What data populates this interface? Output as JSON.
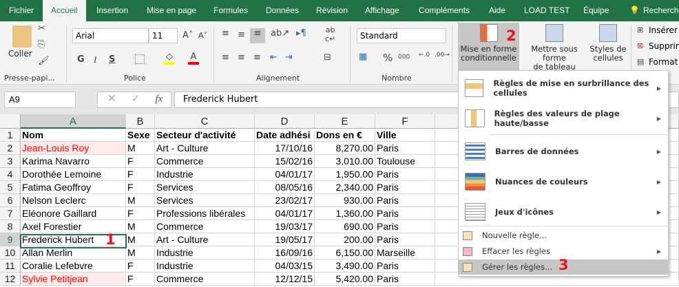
{
  "tabs": [
    "Fichier",
    "Accueil",
    "Insertion",
    "Mise en page",
    "Formules",
    "Données",
    "Révision",
    "Affichage",
    "Compléments",
    "Aide",
    "LOAD TEST",
    "Équipe",
    "Recherch"
  ],
  "ribbon": {
    "clipboard": {
      "paste": "Coller",
      "label": "Presse-papi..."
    },
    "font": {
      "name": "Arial",
      "size": "11",
      "label": "Police",
      "bold": "G",
      "italic": "I",
      "underline": "S",
      "font_color": "A"
    },
    "alignment": {
      "label": "Alignement"
    },
    "number": {
      "format": "Standard",
      "label": "Nombre",
      "percent": "%",
      "thousands": "000"
    },
    "styles": {
      "conditional": "Mise en forme",
      "conditional2": "conditionnelle",
      "table": "Mettre sous forme",
      "table2": "de tableau",
      "cell_styles": "Styles de",
      "cell_styles2": "cellules"
    },
    "cells": {
      "insert": "Insérer",
      "delete": "Supprim",
      "format": "Format"
    }
  },
  "formula_bar": {
    "name_box": "A9",
    "fx": "fx",
    "value": "Frederick Hubert"
  },
  "columns": [
    "A",
    "B",
    "C",
    "D",
    "E",
    "F"
  ],
  "rows": [
    {
      "n": "1",
      "cells": [
        "Nom",
        "Sexe",
        "Secteur d'activité",
        "Date adhési",
        "Dons en €",
        "Ville"
      ]
    },
    {
      "n": "2",
      "cells": [
        "Jean-Louis Roy",
        "M",
        "Art - Culture",
        "17/10/16",
        "8,270.00",
        "Paris"
      ]
    },
    {
      "n": "3",
      "cells": [
        "Karima Navarro",
        "F",
        "Commerce",
        "15/02/16",
        "3,010.00",
        "Toulouse"
      ]
    },
    {
      "n": "4",
      "cells": [
        "Dorothée Lemoine",
        "F",
        "Industrie",
        "04/01/17",
        "1,950.00",
        "Paris"
      ]
    },
    {
      "n": "5",
      "cells": [
        "Fatima Geoffroy",
        "F",
        "Services",
        "08/05/16",
        "2,340.00",
        "Paris"
      ]
    },
    {
      "n": "6",
      "cells": [
        "Nelson Leclerc",
        "M",
        "Services",
        "23/02/17",
        "930.00",
        "Paris"
      ]
    },
    {
      "n": "7",
      "cells": [
        "Eléonore Gaillard",
        "F",
        "Professions libérales",
        "04/01/17",
        "1,360.00",
        "Paris"
      ]
    },
    {
      "n": "8",
      "cells": [
        "Axel Forestier",
        "M",
        "Commerce",
        "19/03/17",
        "690.00",
        "Paris"
      ]
    },
    {
      "n": "9",
      "cells": [
        "Frederick Hubert",
        "M",
        "Art - Culture",
        "19/05/17",
        "200.00",
        "Paris"
      ]
    },
    {
      "n": "10",
      "cells": [
        "Allan Merlin",
        "M",
        "Industrie",
        "16/09/16",
        "6,150.00",
        "Marseille"
      ]
    },
    {
      "n": "11",
      "cells": [
        "Coralie Lefebvre",
        "F",
        "Industrie",
        "04/03/15",
        "3,490.00",
        "Paris"
      ]
    },
    {
      "n": "12",
      "cells": [
        "Sylvie Petitjean",
        "F",
        "Commerce",
        "12/12/15",
        "5,420.00",
        "Paris"
      ]
    }
  ],
  "menu": {
    "big": [
      "Règles de mise en surbrillance des cellules",
      "Règles des valeurs de plage haute/basse",
      "Barres de données",
      "Nuances de couleurs",
      "Jeux d'icônes"
    ],
    "small": [
      "Nouvelle règle...",
      "Effacer les règles",
      "Gérer les règles..."
    ]
  },
  "annotations": [
    "1",
    "2",
    "3"
  ],
  "colors": {
    "brand": "#217346",
    "highlight_text": "#ff0000",
    "annotation": "#e8151a"
  }
}
